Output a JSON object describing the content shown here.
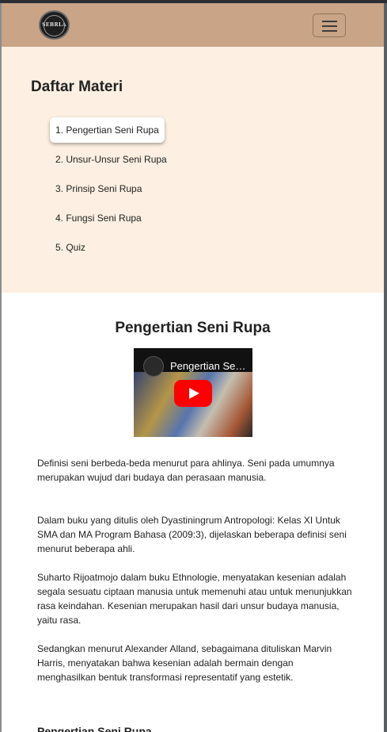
{
  "navbar": {
    "logo_text": "SEBRLA",
    "toggler_label": "menu"
  },
  "sidebar": {
    "title": "Daftar Materi",
    "items": [
      {
        "label": "1. Pengertian Seni Rupa",
        "active": true
      },
      {
        "label": "2. Unsur-Unsur Seni Rupa",
        "active": false
      },
      {
        "label": "3. Prinsip Seni Rupa",
        "active": false
      },
      {
        "label": "4. Fungsi Seni Rupa",
        "active": false
      },
      {
        "label": "5. Quiz",
        "active": false
      }
    ]
  },
  "content": {
    "title": "Pengertian Seni Rupa",
    "video": {
      "title": "Pengertian Seni Rupa",
      "play_icon": "play-icon"
    },
    "paragraphs": [
      "Definisi seni berbeda-beda menurut para ahlinya. Seni pada umumnya merupakan wujud dari budaya dan perasaan manusia.",
      "Dalam buku yang ditulis oleh Dyastiningrum Antropologi: Kelas XI Untuk SMA dan MA Program Bahasa (2009:3), dijelaskan beberapa definisi seni menurut beberapa ahli.",
      "Suharto Rijoatmojo dalam buku Ethnologie, menyatakan kesenian adalah segala sesuatu ciptaan manusia untuk memenuhi atau untuk menunjukkan rasa keindahan. Kesenian merupakan hasil dari unsur budaya manusia, yaitu rasa.",
      "Sedangkan menurut Alexander Alland, sebagaimana dituliskan Marvin Harris, menyatakan bahwa kesenian adalah bermain dengan menghasilkan bentuk transformasi representatif yang estetik."
    ],
    "next_heading": "Pengertian Seni Rupa"
  },
  "colors": {
    "navbar": "#c9a486",
    "sidebar_bg": "#fdf0e2",
    "play_button": "#ff0000"
  }
}
